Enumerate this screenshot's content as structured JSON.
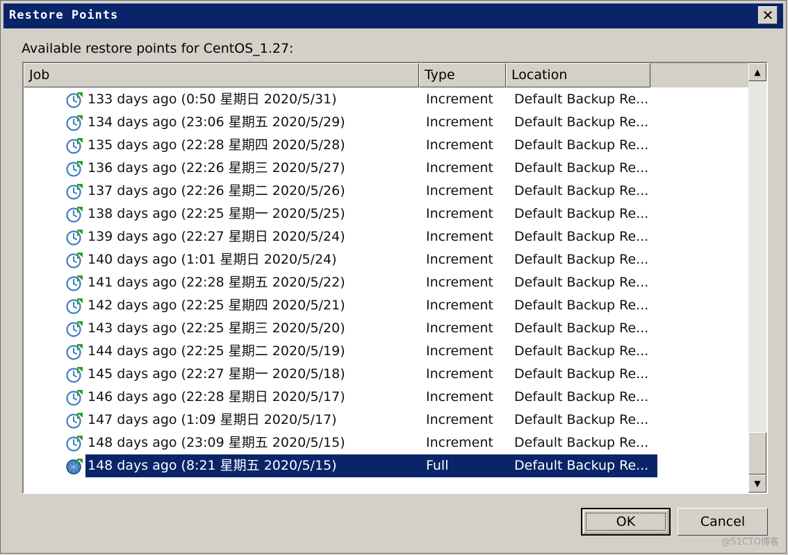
{
  "window": {
    "title": "Restore Points",
    "close_glyph": "✕"
  },
  "caption": "Available restore points for CentOS_1.27:",
  "columns": {
    "job": "Job",
    "type": "Type",
    "location": "Location"
  },
  "rows": [
    {
      "job": "133 days ago (0:50 星期日 2020/5/31)",
      "type": "Increment",
      "location": "Default Backup Re...",
      "icon": "increment-restore-point-icon"
    },
    {
      "job": "134 days ago (23:06 星期五 2020/5/29)",
      "type": "Increment",
      "location": "Default Backup Re...",
      "icon": "increment-restore-point-icon"
    },
    {
      "job": "135 days ago (22:28 星期四 2020/5/28)",
      "type": "Increment",
      "location": "Default Backup Re...",
      "icon": "increment-restore-point-icon"
    },
    {
      "job": "136 days ago (22:26 星期三 2020/5/27)",
      "type": "Increment",
      "location": "Default Backup Re...",
      "icon": "increment-restore-point-icon"
    },
    {
      "job": "137 days ago (22:26 星期二 2020/5/26)",
      "type": "Increment",
      "location": "Default Backup Re...",
      "icon": "increment-restore-point-icon"
    },
    {
      "job": "138 days ago (22:25 星期一 2020/5/25)",
      "type": "Increment",
      "location": "Default Backup Re...",
      "icon": "increment-restore-point-icon"
    },
    {
      "job": "139 days ago (22:27 星期日 2020/5/24)",
      "type": "Increment",
      "location": "Default Backup Re...",
      "icon": "increment-restore-point-icon"
    },
    {
      "job": "140 days ago (1:01 星期日 2020/5/24)",
      "type": "Increment",
      "location": "Default Backup Re...",
      "icon": "increment-restore-point-icon"
    },
    {
      "job": "141 days ago (22:28 星期五 2020/5/22)",
      "type": "Increment",
      "location": "Default Backup Re...",
      "icon": "increment-restore-point-icon"
    },
    {
      "job": "142 days ago (22:25 星期四 2020/5/21)",
      "type": "Increment",
      "location": "Default Backup Re...",
      "icon": "increment-restore-point-icon"
    },
    {
      "job": "143 days ago (22:25 星期三 2020/5/20)",
      "type": "Increment",
      "location": "Default Backup Re...",
      "icon": "increment-restore-point-icon"
    },
    {
      "job": "144 days ago (22:25 星期二 2020/5/19)",
      "type": "Increment",
      "location": "Default Backup Re...",
      "icon": "increment-restore-point-icon"
    },
    {
      "job": "145 days ago (22:27 星期一 2020/5/18)",
      "type": "Increment",
      "location": "Default Backup Re...",
      "icon": "increment-restore-point-icon"
    },
    {
      "job": "146 days ago (22:28 星期日 2020/5/17)",
      "type": "Increment",
      "location": "Default Backup Re...",
      "icon": "increment-restore-point-icon"
    },
    {
      "job": "147 days ago (1:09 星期日 2020/5/17)",
      "type": "Increment",
      "location": "Default Backup Re...",
      "icon": "increment-restore-point-icon"
    },
    {
      "job": "148 days ago (23:09 星期五 2020/5/15)",
      "type": "Increment",
      "location": "Default Backup Re...",
      "icon": "increment-restore-point-icon"
    },
    {
      "job": "148 days ago (8:21 星期五 2020/5/15)",
      "type": "Full",
      "location": "Default Backup Re...",
      "icon": "full-restore-point-icon",
      "selected": true
    }
  ],
  "buttons": {
    "ok": "OK",
    "cancel": "Cancel"
  },
  "scrollbar": {
    "up_glyph": "▲",
    "down_glyph": "▼",
    "position": "bottom"
  },
  "watermark": "@51CTO博客",
  "colors": {
    "titlebar": "#0a246a",
    "selection": "#0a246a",
    "dialog_bg": "#d4d0c8",
    "icon_blue": "#3d7dc0",
    "icon_green": "#2ca02c"
  }
}
